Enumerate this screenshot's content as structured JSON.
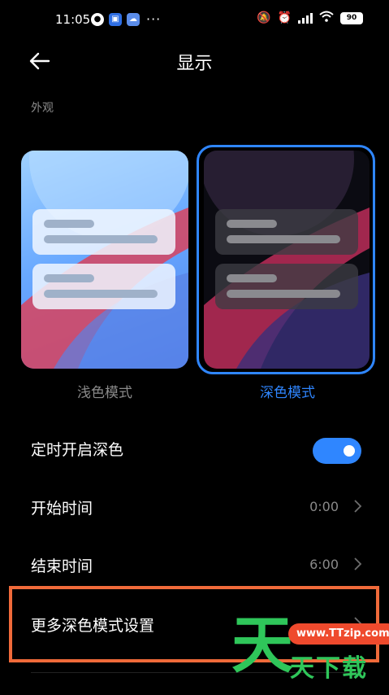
{
  "status_bar": {
    "time": "11:05",
    "icons_left": [
      "globe-icon",
      "app-badge-icon",
      "cloud-app-icon"
    ],
    "more": "···",
    "battery": "90"
  },
  "header": {
    "title": "显示"
  },
  "section": {
    "appearance_label": "外观"
  },
  "themes": {
    "light_label": "浅色模式",
    "dark_label": "深色模式",
    "selected": "dark",
    "accent_color": "#2f86ff"
  },
  "settings": {
    "schedule_label": "定时开启深色",
    "schedule_enabled": true,
    "start_label": "开始时间",
    "start_value": "0:00",
    "end_label": "结束时间",
    "end_value": "6:00",
    "more_label": "更多深色模式设置"
  },
  "watermark": {
    "big_char": "天",
    "url": "www.TTzip.com",
    "text": "天下载"
  }
}
